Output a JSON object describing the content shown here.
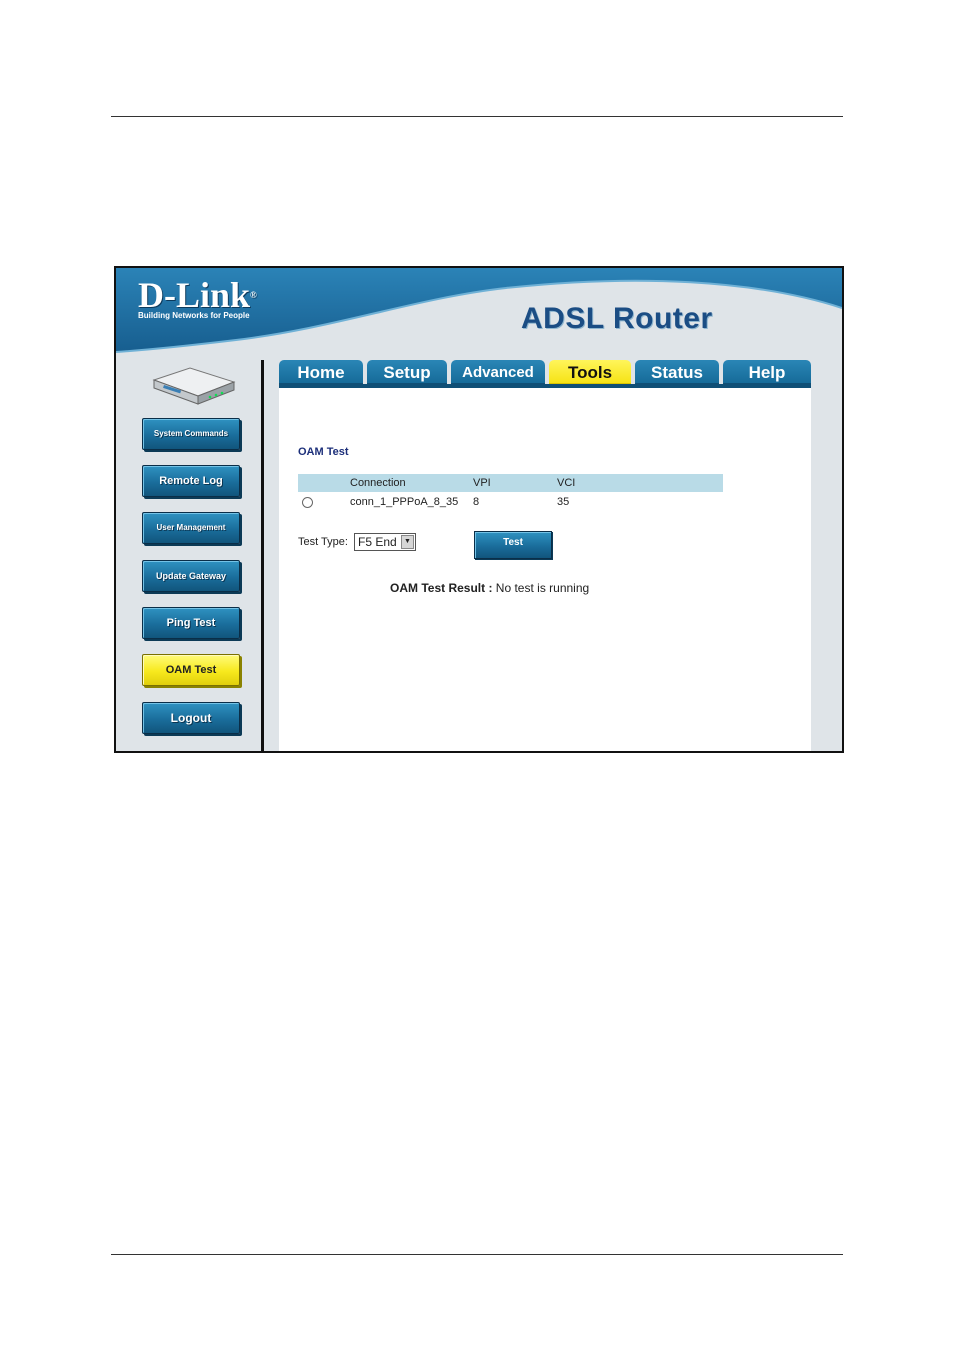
{
  "logo": {
    "brand": "D-Link",
    "registered": "®",
    "tagline": "Building Networks for People"
  },
  "product_title": "ADSL Router",
  "tabs": [
    {
      "label": "Home"
    },
    {
      "label": "Setup"
    },
    {
      "label": "Advanced"
    },
    {
      "label": "Tools",
      "active": true
    },
    {
      "label": "Status"
    },
    {
      "label": "Help"
    }
  ],
  "sidebar": {
    "items": [
      {
        "label": "System Commands"
      },
      {
        "label": "Remote Log"
      },
      {
        "label": "User Management"
      },
      {
        "label": "Update Gateway"
      },
      {
        "label": "Ping Test"
      },
      {
        "label": "OAM Test",
        "active": true
      },
      {
        "label": "Logout"
      }
    ]
  },
  "main": {
    "title": "OAM Test",
    "table": {
      "headers": [
        "",
        "Connection",
        "VPI",
        "VCI"
      ],
      "rows": [
        {
          "connection": "conn_1_PPPoA_8_35",
          "vpi": "8",
          "vci": "35",
          "selected": false
        }
      ]
    },
    "test_type_label": "Test Type:",
    "test_type_value": "F5 End",
    "test_button_label": "Test",
    "result_label": "OAM Test Result :",
    "result_value": "No test is running"
  },
  "colors": {
    "header_blue": "#1d6fa5",
    "active_yellow": "#f7e91d",
    "table_header_bg": "#b9dbe7",
    "title_navy": "#1c2f7a"
  }
}
